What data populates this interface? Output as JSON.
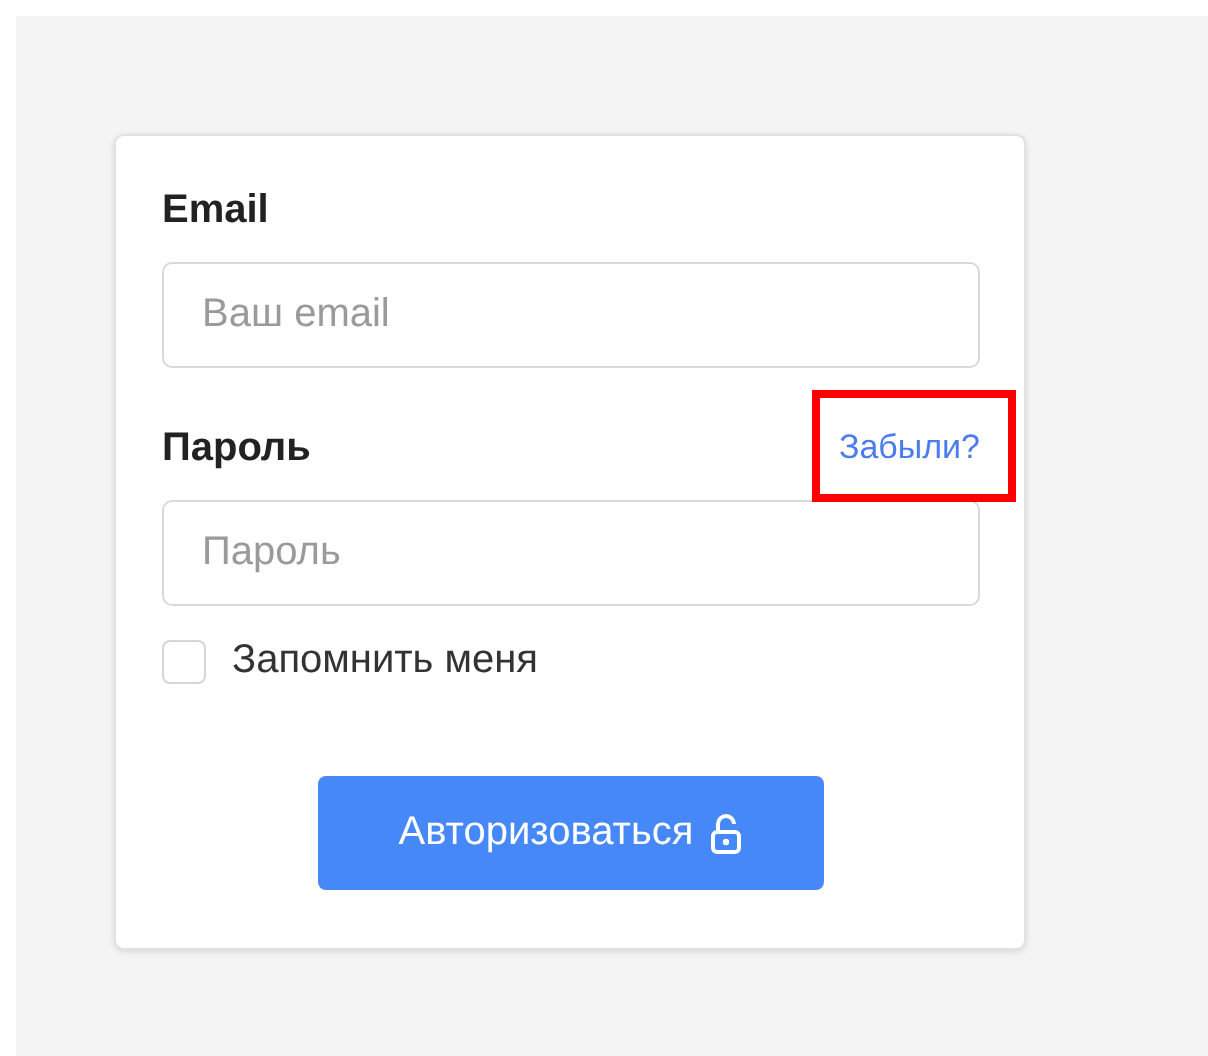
{
  "email": {
    "label": "Email",
    "placeholder": "Ваш email"
  },
  "password": {
    "label": "Пароль",
    "placeholder": "Пароль",
    "forgot_link": {
      "text": "Забыли?",
      "highlighted": true
    }
  },
  "remember": {
    "label": "Запомнить меня",
    "checked": false
  },
  "submit": {
    "label": "Авторизоваться"
  }
}
